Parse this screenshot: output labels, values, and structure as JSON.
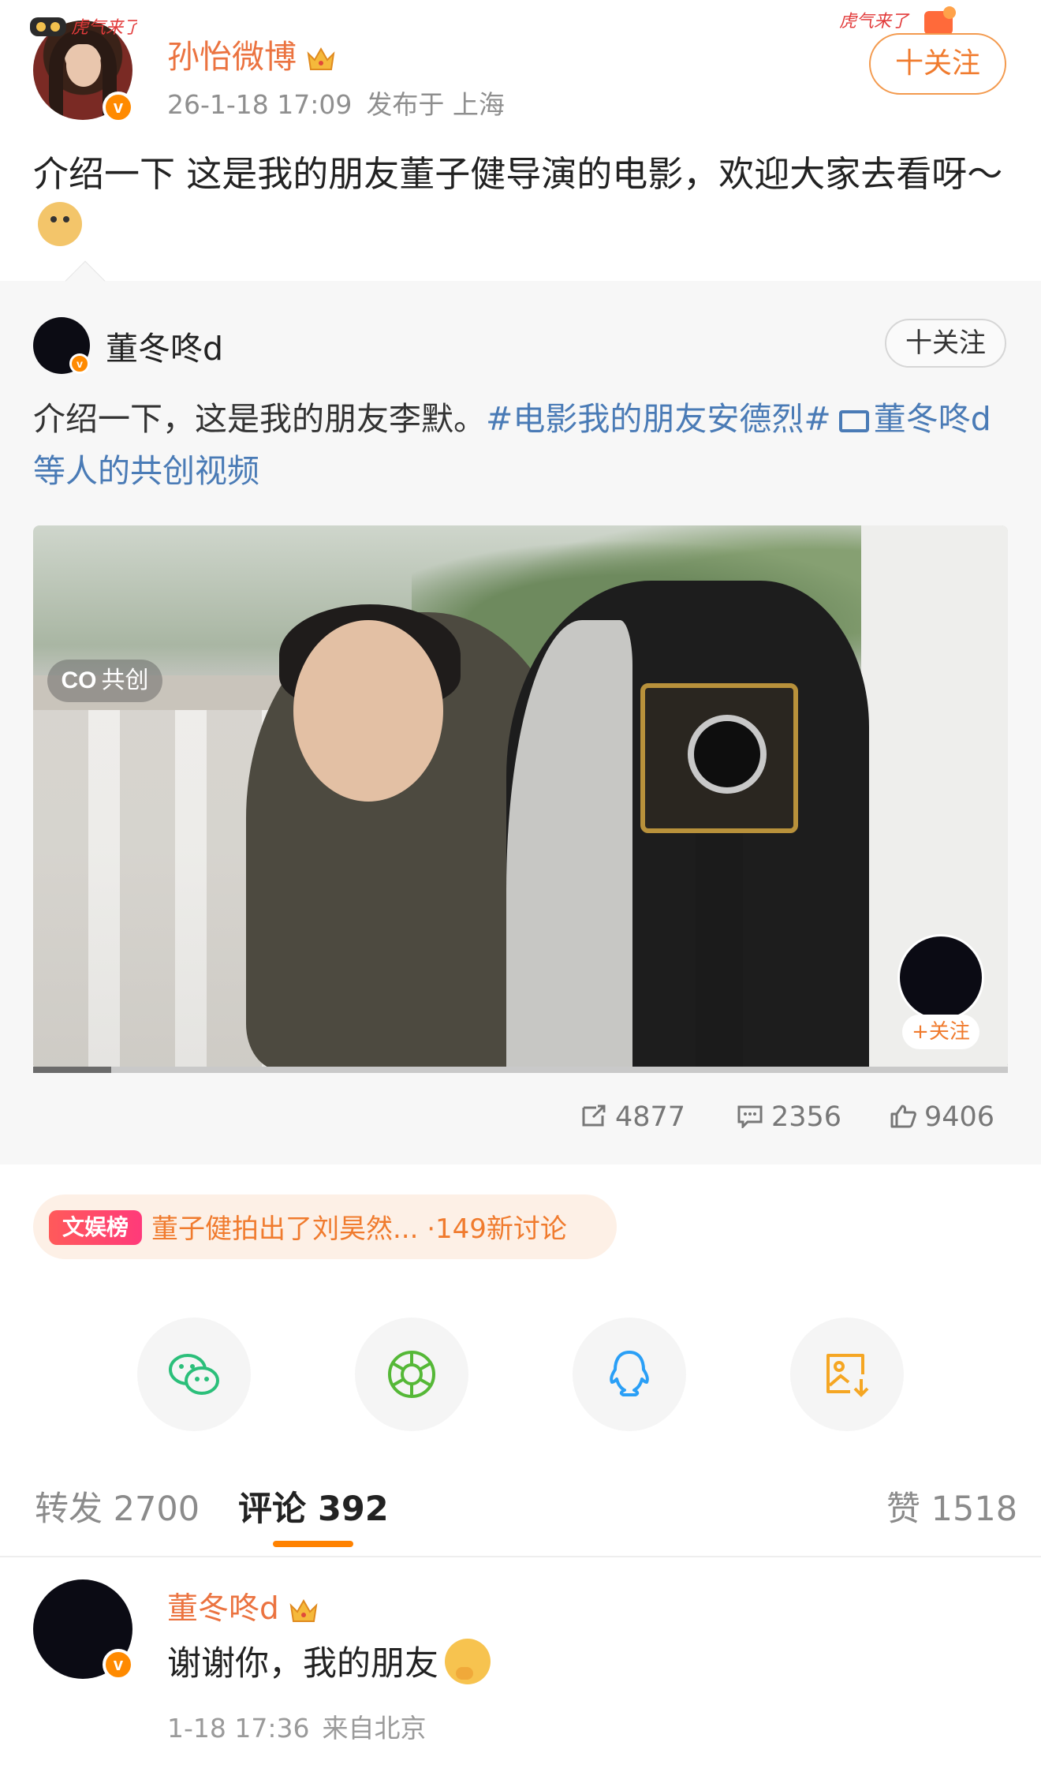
{
  "post": {
    "username": "孙怡微博",
    "timestamp": "26-1-18 17:09",
    "location": "发布于 上海",
    "follow_label": "十关注",
    "text": "介绍一下 这是我的朋友董子健导演的电影，欢迎大家去看呀～",
    "emoji": "doge-emoji",
    "brand_color": "#eb7340"
  },
  "retweet": {
    "username": "董冬咚d",
    "follow_label": "十关注",
    "text_plain": "介绍一下，这是我的朋友李默。",
    "hashtag": "#电影我的朋友安德烈#",
    "video_link": "董冬咚d等人的共创视频",
    "co_tag": "共创",
    "co_tag_prefix": "CO",
    "video_progress": 0.08,
    "author_follow_label": "+关注",
    "stats": {
      "reposts": "4877",
      "comments": "2356",
      "likes": "9406"
    },
    "link_color": "#4a7bb6"
  },
  "topic": {
    "badge": "文娱榜",
    "text": "董子健拍出了刘昊然... ·149新讨论"
  },
  "share_buttons": [
    {
      "name": "wechat-icon",
      "color": "#2bbf7a"
    },
    {
      "name": "moments-icon",
      "color": "#55b837"
    },
    {
      "name": "qq-icon",
      "color": "#2a9ff6"
    },
    {
      "name": "save-image-icon",
      "color": "#f5a623"
    }
  ],
  "tabs": {
    "repost": "转发 2700",
    "comment": "评论 392",
    "like": "赞 1518",
    "accent_color": "#ff8200"
  },
  "comment": {
    "username": "董冬咚d",
    "text": "谢谢你，我的朋友",
    "timestamp": "1-18 17:36",
    "source": "来自北京"
  }
}
